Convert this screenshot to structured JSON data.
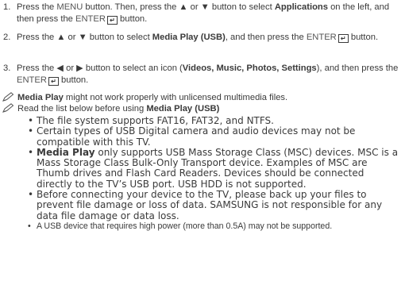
{
  "steps": [
    {
      "number": "1.",
      "parts": [
        "Press the ",
        "MENU",
        " button. Then, press the ",
        "▲",
        " or ",
        "▼",
        " button to select ",
        "Applications",
        " on the left, and then press the ",
        "ENTER",
        " button."
      ]
    },
    {
      "number": "2.",
      "parts": [
        "Press the ",
        "▲",
        " or ",
        "▼",
        " button to select ",
        "Media Play (USB)",
        ", and then press the ",
        "ENTER",
        " button."
      ]
    },
    {
      "number": "3.",
      "parts": [
        "Press the ",
        "◀",
        " or ",
        "▶",
        " button to select an icon (",
        "Videos, Music, Photos, Settings",
        "), and then press the ",
        "ENTER",
        " button."
      ]
    }
  ],
  "notes": [
    {
      "parts": [
        "Media Play",
        " might not work properly with unlicensed multimedia files."
      ]
    },
    {
      "parts": [
        "Read the list below before using ",
        "Media Play (USB)"
      ]
    }
  ],
  "bullets": [
    "The file system supports FAT16, FAT32, and NTFS.",
    "Certain types of USB Digital camera and audio devices may not be compatible with this TV.",
    {
      "bold": "Media Play",
      "rest": " only supports USB Mass Storage Class (MSC) devices. MSC is a Mass Storage Class Bulk-Only Transport device. Examples of MSC are Thumb drives and Flash Card Readers. Devices should be connected directly to the TV’s USB port. USB HDD is not supported."
    },
    "Before connecting your device to the TV, please back up your files to prevent file damage or loss of data. SAMSUNG is not responsible for any data file damage or data loss.",
    "A USB device that requires high power (more than 0.5A) may not be supported."
  ],
  "bullet_glyph": "•",
  "enter_icon": "enter-key-icon",
  "note_icon": "pencil-note-icon"
}
